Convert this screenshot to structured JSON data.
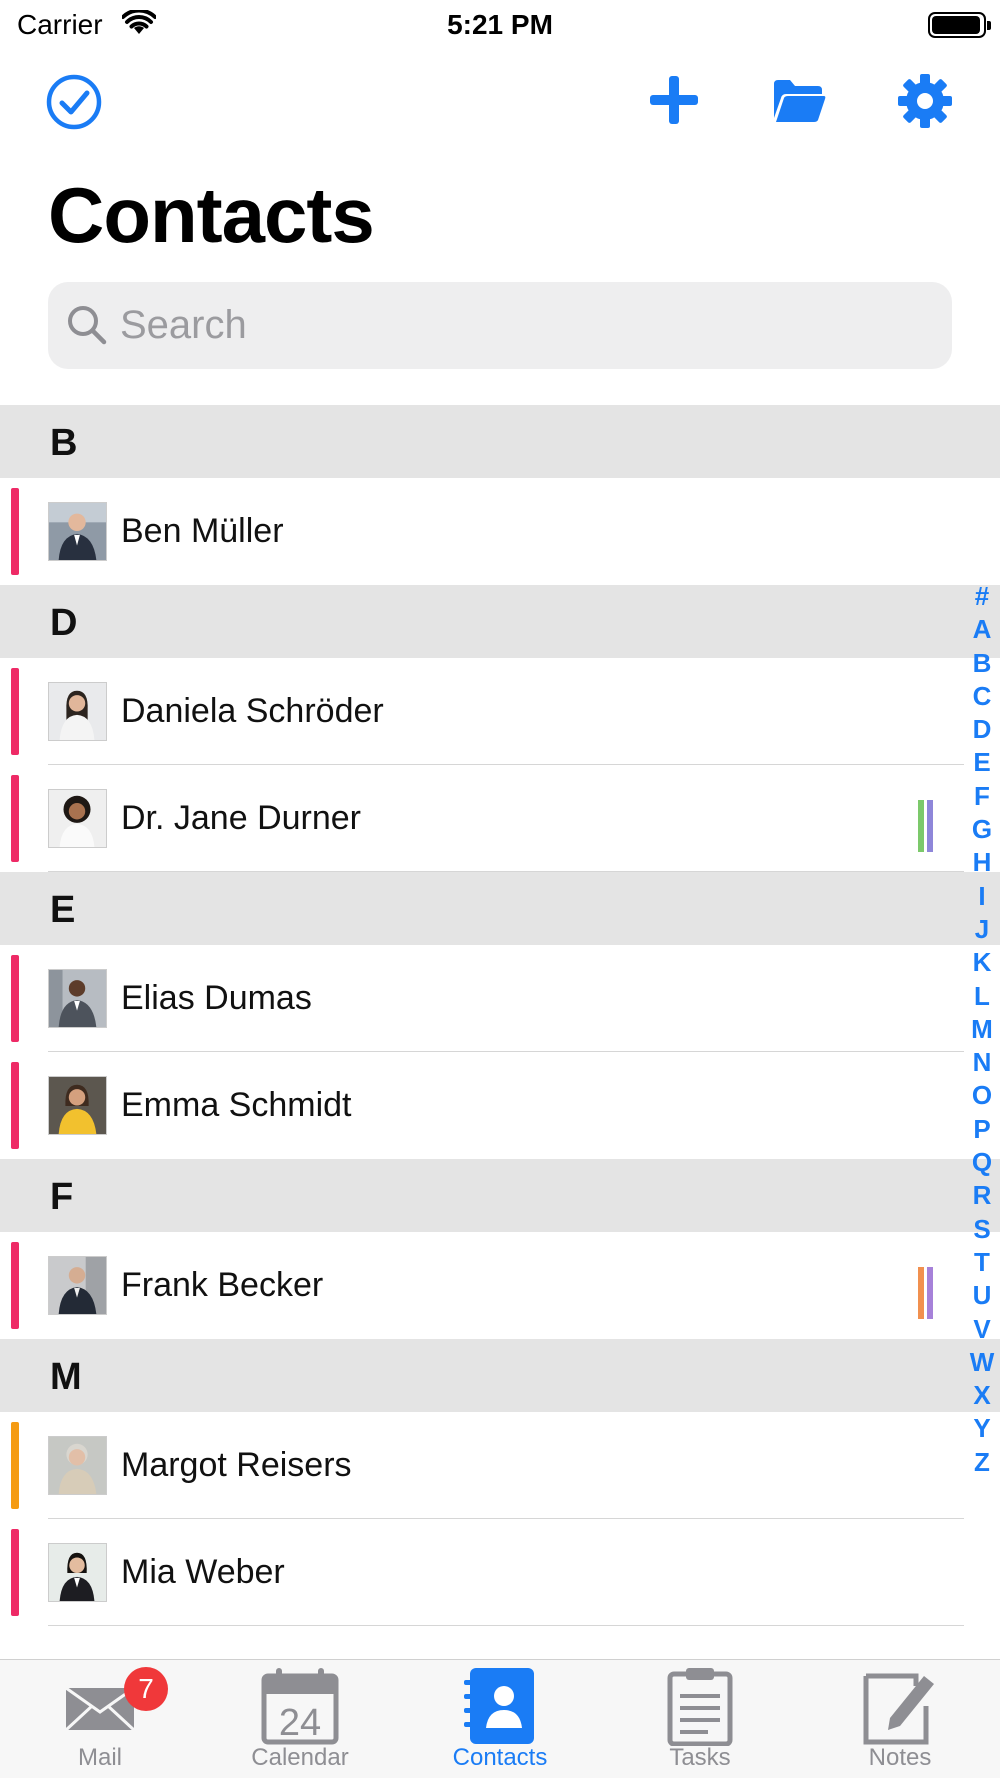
{
  "status_bar": {
    "carrier": "Carrier",
    "time": "5:21 PM"
  },
  "toolbar": {
    "select_icon": "checkmark-circle-icon",
    "add_icon": "plus-icon",
    "folder_icon": "folder-icon",
    "settings_icon": "gear-icon",
    "accent_color": "#1a7cf5"
  },
  "title": "Contacts",
  "search": {
    "placeholder": "Search",
    "value": ""
  },
  "sections": [
    {
      "letter": "B",
      "contacts": [
        {
          "name": "Ben Müller",
          "bar_color": "#ee2a66",
          "tags": []
        }
      ]
    },
    {
      "letter": "D",
      "contacts": [
        {
          "name": "Daniela Schröder",
          "bar_color": "#ee2a66",
          "tags": []
        },
        {
          "name": "Dr.  Jane Durner",
          "bar_color": "#ee2a66",
          "tags": [
            "#7cc96b",
            "#8e86d9"
          ]
        }
      ]
    },
    {
      "letter": "E",
      "contacts": [
        {
          "name": "Elias Dumas",
          "bar_color": "#ee2a66",
          "tags": []
        },
        {
          "name": "Emma Schmidt",
          "bar_color": "#ee2a66",
          "tags": []
        }
      ]
    },
    {
      "letter": "F",
      "contacts": [
        {
          "name": "Frank Becker",
          "bar_color": "#ee2a66",
          "tags": [
            "#f1904f",
            "#a681d9"
          ]
        }
      ]
    },
    {
      "letter": "M",
      "contacts": [
        {
          "name": "Margot Reisers",
          "bar_color": "#f59b12",
          "tags": []
        },
        {
          "name": "Mia Weber",
          "bar_color": "#ee2a66",
          "tags": []
        }
      ]
    }
  ],
  "index_letters": [
    "#",
    "A",
    "B",
    "C",
    "D",
    "E",
    "F",
    "G",
    "H",
    "I",
    "J",
    "K",
    "L",
    "M",
    "N",
    "O",
    "P",
    "Q",
    "R",
    "S",
    "T",
    "U",
    "V",
    "W",
    "X",
    "Y",
    "Z"
  ],
  "tab_bar": {
    "tabs": [
      {
        "label": "Mail",
        "icon": "envelope-icon",
        "badge": "7",
        "active": false
      },
      {
        "label": "Calendar",
        "icon": "calendar-icon",
        "date": "24",
        "active": false
      },
      {
        "label": "Contacts",
        "icon": "contacts-book-icon",
        "active": true
      },
      {
        "label": "Tasks",
        "icon": "clipboard-icon",
        "active": false
      },
      {
        "label": "Notes",
        "icon": "note-edit-icon",
        "active": false
      }
    ]
  }
}
